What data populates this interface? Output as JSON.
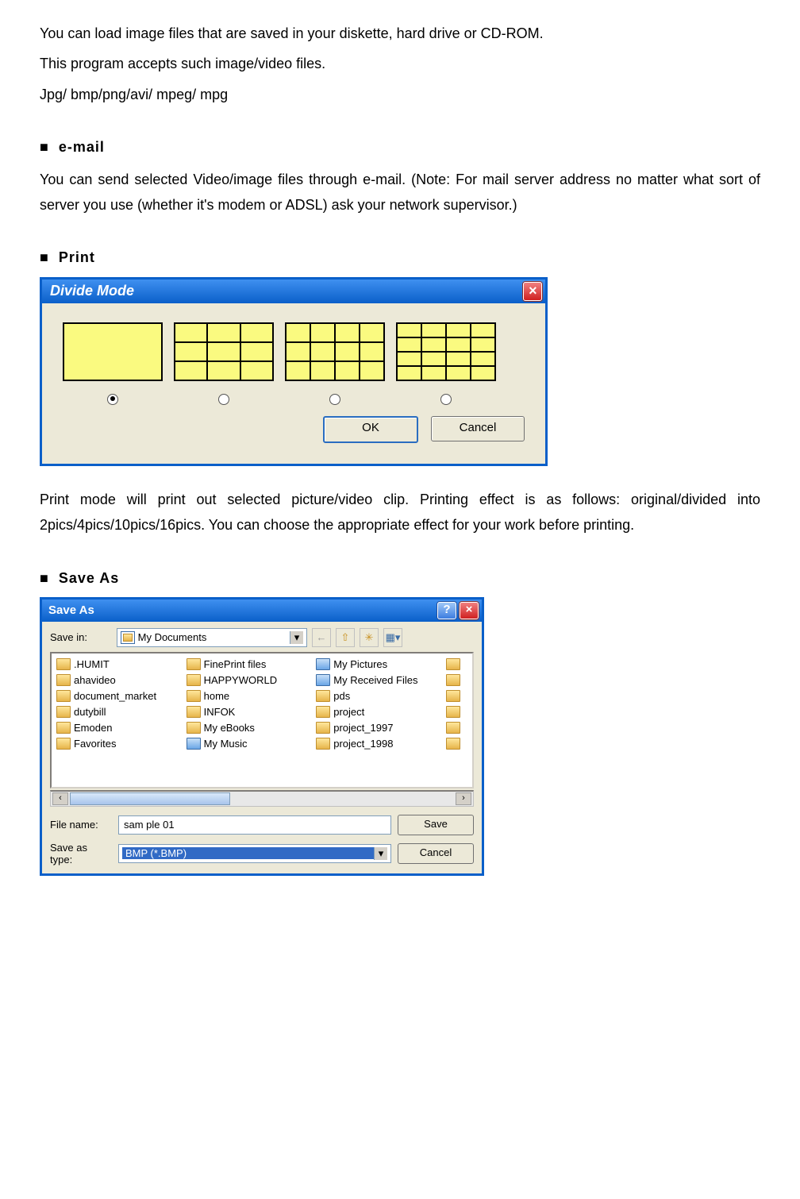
{
  "text": {
    "p1": "You can load image files that are saved in your diskette, hard drive or CD-ROM.",
    "p2": "This program accepts such image/video files.",
    "p3": "Jpg/ bmp/png/avi/ mpeg/ mpg",
    "head_email": "e-mail",
    "p4": "You can send selected Video/image files through e-mail. (Note: For mail server address no matter what sort of server you use (whether it's modem or ADSL) ask your network supervisor.)",
    "head_print": "Print",
    "p5": "Print mode will print out selected picture/video clip. Printing effect is as follows: original/divided into 2pics/4pics/10pics/16pics. You can choose the appropriate effect for your work before printing.",
    "head_saveas": "Save As"
  },
  "divideDialog": {
    "title": "Divide Mode",
    "ok": "OK",
    "cancel": "Cancel",
    "selected": 0
  },
  "saveDialog": {
    "title": "Save As",
    "saveInLabel": "Save in:",
    "saveInValue": "My Documents",
    "filenameLabel": "File name:",
    "filenameValue": "sam ple 01",
    "typeLabel": "Save as type:",
    "typeValue": "BMP (*.BMP)",
    "saveBtn": "Save",
    "cancelBtn": "Cancel",
    "columns": [
      [
        ".HUMIT",
        "ahavideo",
        "document_market",
        "dutybill",
        "Emoden",
        "Favorites"
      ],
      [
        "FinePrint files",
        "HAPPYWORLD",
        "home",
        "INFOK",
        "My eBooks",
        "My Music"
      ],
      [
        "My Pictures",
        "My Received Files",
        "pds",
        "project",
        "project_1997",
        "project_1998"
      ]
    ],
    "specialFolders": [
      "My Pictures",
      "My Received Files",
      "My Music"
    ]
  }
}
